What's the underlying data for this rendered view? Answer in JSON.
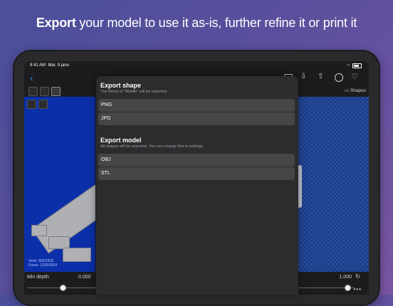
{
  "headline": {
    "bold": "Export",
    "rest": " your model to use it as-is, further refine it or print it"
  },
  "statusbar": {
    "time": "9:41 AM",
    "date": "Mar. 9 janv.",
    "battery": "100 %"
  },
  "navbar": {
    "back": "‹",
    "title": "Shapes"
  },
  "viewport": {
    "stats_line1": "Verts: 802/1918",
    "stats_line2": "Faces: 1200/3624"
  },
  "bottom": {
    "min_depth_label": "Min depth",
    "min_depth_value": "0.000",
    "right_value": "1.000",
    "more": "•••"
  },
  "sheet": {
    "shape_section": {
      "title": "Export shape",
      "subtitle": "The Recto of \"Middle\" will be exported.",
      "options": [
        "PNG",
        "JPG"
      ]
    },
    "model_section": {
      "title": "Export model",
      "subtitle": "All shapes will be exported. You can change this in settings.",
      "options": [
        "OBJ",
        "STL"
      ]
    }
  },
  "colors": {
    "accent": "#3b8bff",
    "viewport_blue": "#0b2fa8",
    "sheet_bg": "#2c2c2e",
    "option_bg": "#464649"
  }
}
